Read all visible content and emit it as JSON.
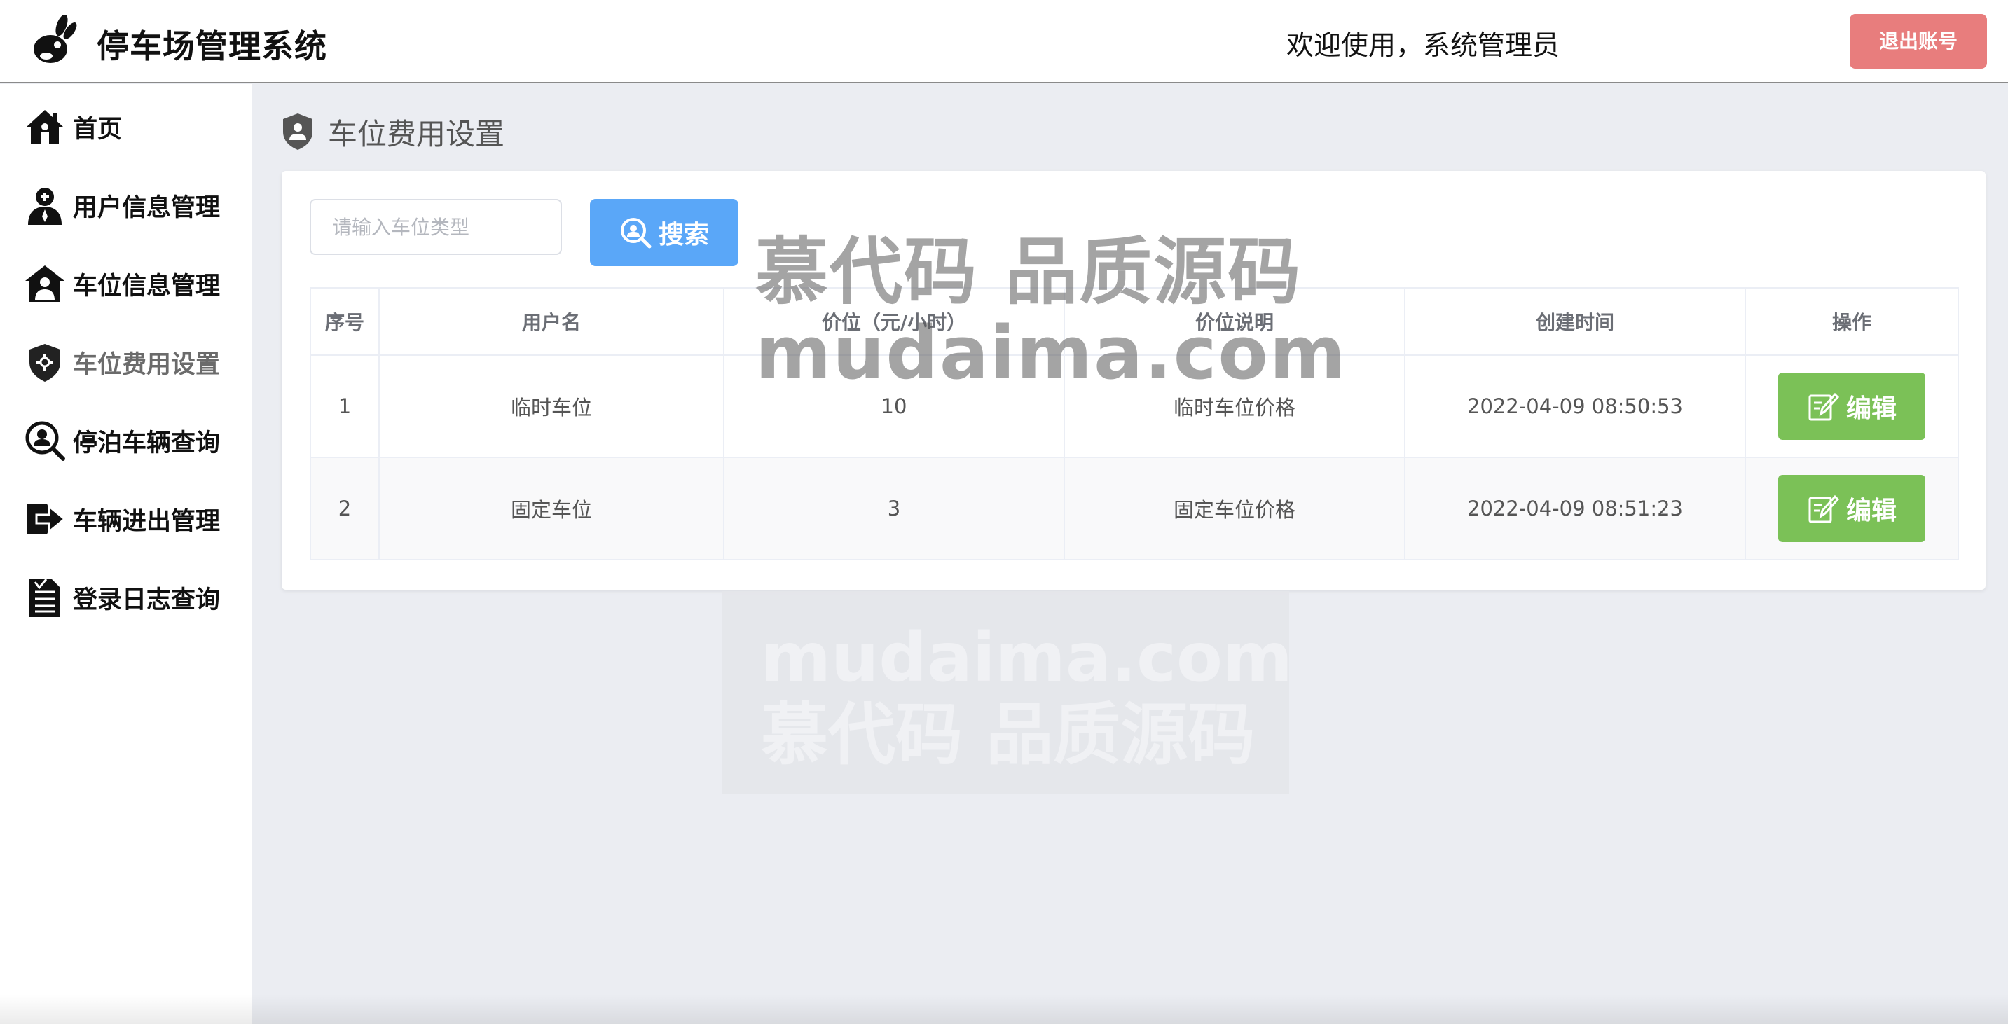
{
  "header": {
    "app_title": "停车场管理系统",
    "welcome_text": "欢迎使用，系统管理员",
    "logout_label": "退出账号"
  },
  "sidebar": {
    "items": [
      {
        "label": "首页",
        "icon": "home-icon",
        "active": false
      },
      {
        "label": "用户信息管理",
        "icon": "user-icon",
        "active": false
      },
      {
        "label": "车位信息管理",
        "icon": "parking-house-icon",
        "active": false
      },
      {
        "label": "车位费用设置",
        "icon": "shield-icon",
        "active": true
      },
      {
        "label": "停泊车辆查询",
        "icon": "search-user-icon",
        "active": false
      },
      {
        "label": "车辆进出管理",
        "icon": "arrow-right-icon",
        "active": false
      },
      {
        "label": "登录日志查询",
        "icon": "document-list-icon",
        "active": false
      }
    ]
  },
  "main": {
    "page_title": "车位费用设置",
    "search": {
      "placeholder": "请输入车位类型",
      "value": "",
      "button_label": "搜索"
    },
    "table": {
      "columns": [
        "序号",
        "用户名",
        "价位（元/小时）",
        "价位说明",
        "创建时间",
        "操作"
      ],
      "rows": [
        {
          "index": "1",
          "name": "临时车位",
          "price": "10",
          "description": "临时车位价格",
          "created": "2022-04-09 08:50:53",
          "action": "编辑"
        },
        {
          "index": "2",
          "name": "固定车位",
          "price": "3",
          "description": "固定车位价格",
          "created": "2022-04-09 08:51:23",
          "action": "编辑"
        }
      ]
    }
  },
  "watermark": {
    "line1": "慕代码 品质源码",
    "line2": "mudaima.com",
    "line3": "mudaima.com",
    "line4": "慕代码 品质源码"
  },
  "colors": {
    "logout": "#e87d7d",
    "search_button": "#5aa7f8",
    "edit_button": "#7bc157",
    "background": "#ebedf2"
  }
}
